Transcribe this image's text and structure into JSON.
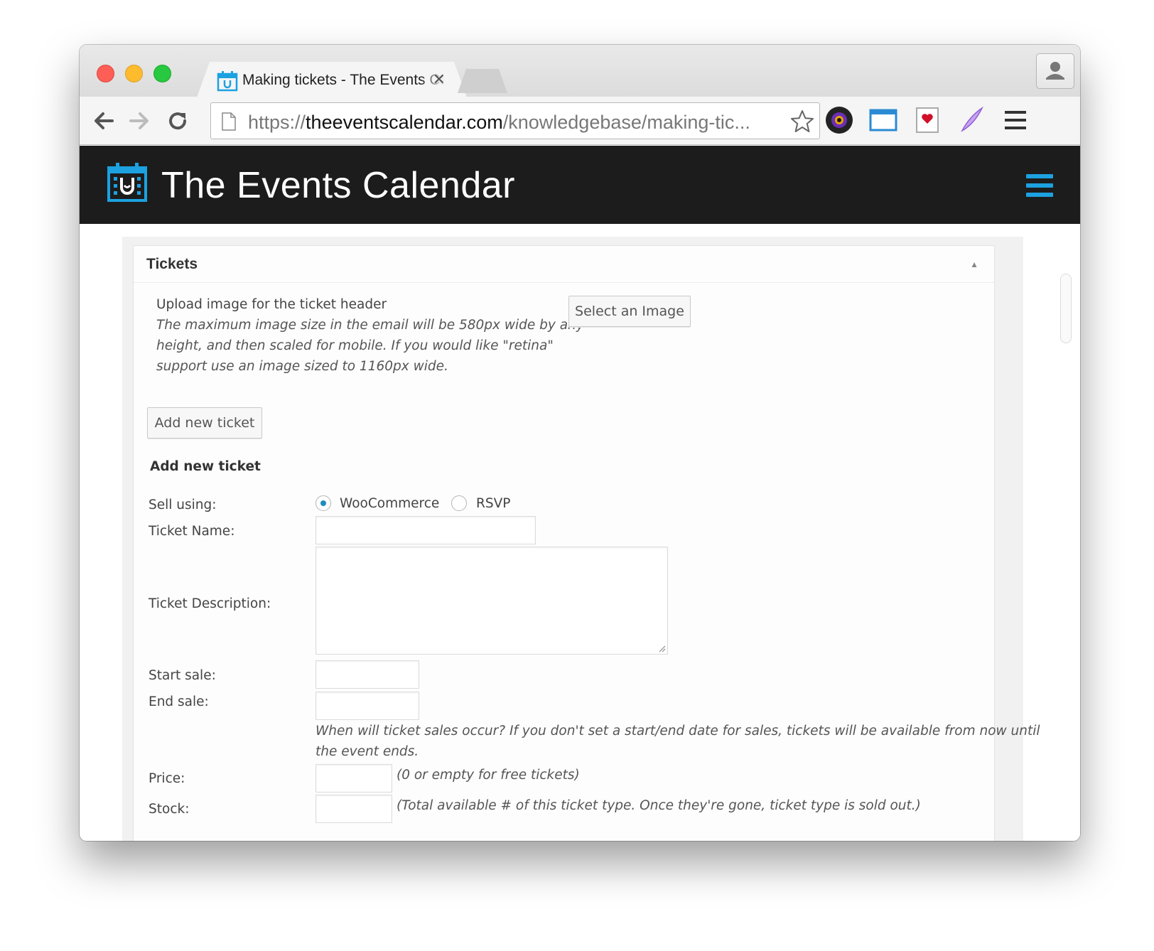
{
  "browser": {
    "tab": {
      "title": "Making tickets - The Events Calendar"
    },
    "address_bar": {
      "scheme": "https://",
      "host": "theeventscalendar.com",
      "path": "/knowledgebase/making-tic..."
    }
  },
  "site": {
    "title": "The Events Calendar",
    "accent_color": "#1ca1e1"
  },
  "metabox": {
    "title": "Tickets",
    "header_image": {
      "label": "Upload image for the ticket header",
      "help_lines": [
        "The maximum image size in the email will be 580px wide by any",
        "height, and then scaled for mobile. If you would like \"retina\"",
        "support use an image sized to 1160px wide."
      ],
      "button": "Select an Image"
    },
    "add_ticket_button": "Add new ticket",
    "form": {
      "heading": "Add new ticket",
      "sell_using": {
        "label": "Sell using:",
        "options": [
          "WooCommerce",
          "RSVP"
        ],
        "selected": "WooCommerce"
      },
      "ticket_name_label": "Ticket Name:",
      "ticket_description_label": "Ticket Description:",
      "start_sale_label": "Start sale:",
      "end_sale_label": "End sale:",
      "sale_help_lines": [
        "When will ticket sales occur? If you don't set a start/end date for sales, tickets will be available from now until",
        "the event ends."
      ],
      "price_label": "Price:",
      "price_help": "(0 or empty for free tickets)",
      "stock_label": "Stock:",
      "stock_help": "(Total available # of this ticket type. Once they're gone, ticket type is sold out.)"
    }
  }
}
